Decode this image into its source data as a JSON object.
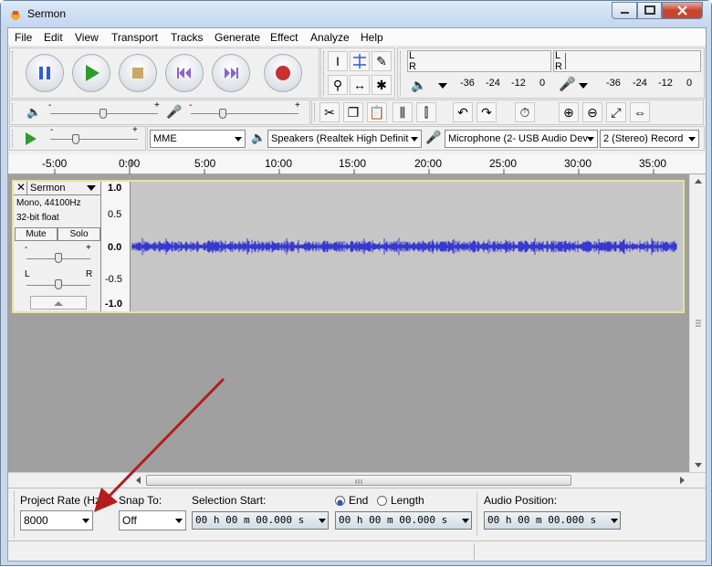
{
  "window": {
    "title": "Sermon"
  },
  "menu": [
    "File",
    "Edit",
    "View",
    "Transport",
    "Tracks",
    "Generate",
    "Effect",
    "Analyze",
    "Help"
  ],
  "meters": {
    "channel_labels": [
      "L",
      "R"
    ],
    "scale": [
      "-36",
      "-24",
      "-12",
      "0"
    ]
  },
  "device": {
    "host": "MME",
    "playback": "Speakers (Realtek High Definit",
    "recording": "Microphone (2- USB Audio Dev",
    "channels": "2 (Stereo) Record"
  },
  "timeline": {
    "labels": [
      "-5:00",
      "0:00",
      "5:00",
      "10:00",
      "15:00",
      "20:00",
      "25:00",
      "30:00",
      "35:00"
    ]
  },
  "track": {
    "name": "Sermon",
    "info1": "Mono, 44100Hz",
    "info2": "32-bit float",
    "mute": "Mute",
    "solo": "Solo",
    "gain_minus": "-",
    "gain_plus": "+",
    "pan_left": "L",
    "pan_right": "R",
    "scale": [
      "1.0",
      "0.5",
      "0.0",
      "-0.5",
      "-1.0"
    ]
  },
  "selection": {
    "project_rate_label": "Project Rate (Hz)",
    "project_rate_value": "8000",
    "snap_label": "Snap To:",
    "snap_value": "Off",
    "selection_start_label": "Selection Start:",
    "selection_start_value": "00 h 00 m 00.000 s",
    "end_label": "End",
    "length_label": "Length",
    "end_value": "00 h 00 m 00.000 s",
    "audio_position_label": "Audio Position:",
    "audio_position_value": "00 h 00 m 00.000 s"
  },
  "colors": {
    "waveform": "#3838d0",
    "annotation_arrow": "#b51c1c"
  }
}
